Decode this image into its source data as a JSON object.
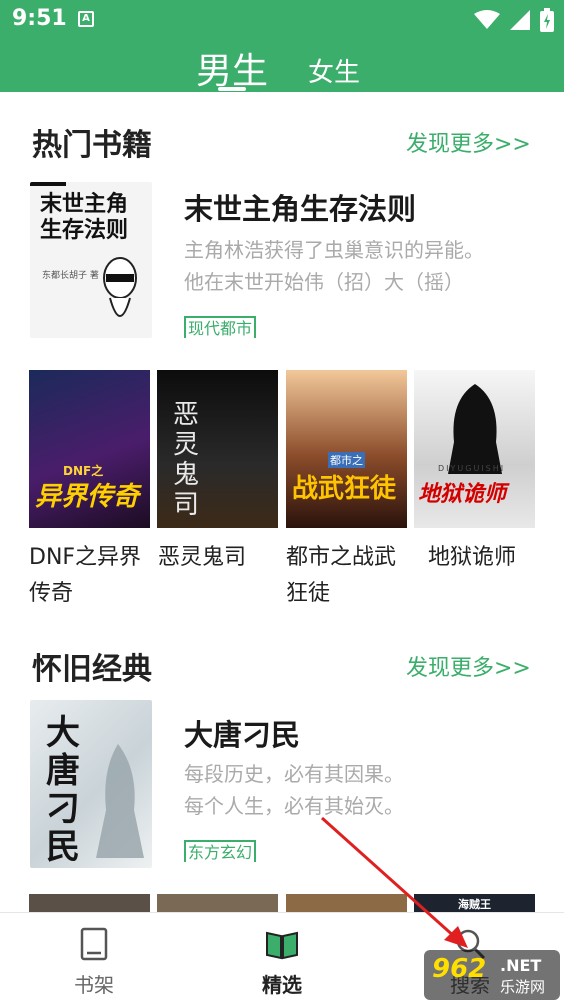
{
  "status_bar": {
    "time": "9:51",
    "notif_icon": "A"
  },
  "header": {
    "tabs": [
      {
        "label": "男生",
        "active": true
      },
      {
        "label": "女生",
        "active": false
      }
    ]
  },
  "hot": {
    "title": "热门书籍",
    "more": "发现更多>>",
    "featured": {
      "title": "末世主角生存法则",
      "desc_line1": "主角林浩获得了虫巢意识的异能。",
      "desc_line2": "他在末世开始伟（招）大（摇）",
      "tag": "现代都市",
      "cover_text": "末世主角生存法则",
      "cover_author": "东都长胡子 著"
    },
    "books": [
      {
        "name_line1": "DNF之异界",
        "name_line2": "传奇",
        "cover_text": "异界传奇",
        "cover_sub": "DNF之"
      },
      {
        "name_line1": "恶灵鬼司",
        "name_line2": "",
        "cover_text": "恶灵鬼司",
        "cover_sub": ""
      },
      {
        "name_line1": "都市之战武",
        "name_line2": "狂徒",
        "cover_text": "战武狂徒",
        "cover_sub": "都市之"
      },
      {
        "name_line1": "地狱诡师",
        "name_line2": "",
        "cover_text": "地狱诡师",
        "cover_sub": "DIYUGUISHI"
      }
    ]
  },
  "classic": {
    "title": "怀旧经典",
    "more": "发现更多>>",
    "featured": {
      "title": "大唐刁民",
      "desc_line1": "每段历史，必有其因果。",
      "desc_line2": "每个人生，必有其始灭。",
      "tag": "东方玄幻",
      "cover_text": "大唐刁民"
    },
    "partial_cover_text": "海贼王"
  },
  "bottom_nav": [
    {
      "label": "书架",
      "icon": "book-icon",
      "active": false
    },
    {
      "label": "精选",
      "icon": "open-book-icon",
      "active": true
    },
    {
      "label": "搜索",
      "icon": "search-icon",
      "active": false
    }
  ],
  "watermark": {
    "big": "962",
    "net": ".NET",
    "small": "乐游网"
  },
  "colors": {
    "accent": "#3aae6a",
    "text": "#222222",
    "muted": "#aaaaaa"
  }
}
